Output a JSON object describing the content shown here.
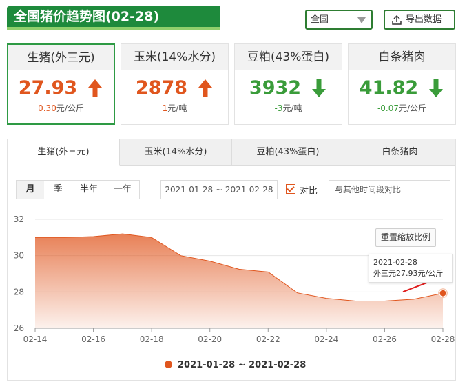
{
  "header": {
    "title": "全国猪价趋势图(02-28)"
  },
  "region": {
    "selected": "全国"
  },
  "export": {
    "label": "导出数据"
  },
  "cards": [
    {
      "title": "生猪(外三元)",
      "value": "27.93",
      "direction": "up",
      "change": "0.30",
      "unit": "元/公斤"
    },
    {
      "title": "玉米(14%水分)",
      "value": "2878",
      "direction": "up",
      "change": "1",
      "unit": "元/吨"
    },
    {
      "title": "豆粕(43%蛋白)",
      "value": "3932",
      "direction": "down",
      "change": "-3",
      "unit": "元/吨"
    },
    {
      "title": "白条猪肉",
      "value": "41.82",
      "direction": "down",
      "change": "-0.07",
      "unit": "元/公斤"
    }
  ],
  "tabs": [
    "生猪(外三元)",
    "玉米(14%水分)",
    "豆粕(43%蛋白)",
    "白条猪肉"
  ],
  "active_tab": 0,
  "ranges": [
    "月",
    "季",
    "半年",
    "一年"
  ],
  "active_range": 0,
  "date_range": "2021-01-28 ~ 2021-02-28",
  "compare": {
    "label": "对比",
    "checked": true,
    "placeholder": "与其他时间段对比"
  },
  "reset_zoom": "重置缩放比例",
  "tooltip": {
    "date": "2021-02-28",
    "text": "外三元27.93元/公斤"
  },
  "colors": {
    "primary": "#1e8a3c",
    "up": "#e0561e",
    "down": "#3a9c3a",
    "line": "#e0561e"
  },
  "chart_data": {
    "type": "area",
    "x": [
      "02-14",
      "02-15",
      "02-16",
      "02-17",
      "02-18",
      "02-19",
      "02-20",
      "02-21",
      "02-22",
      "02-23",
      "02-24",
      "02-25",
      "02-26",
      "02-27",
      "02-28"
    ],
    "series": [
      {
        "name": "2021-01-28 ~ 2021-02-28",
        "values": [
          31.0,
          31.0,
          31.05,
          31.2,
          31.0,
          30.0,
          29.7,
          29.25,
          29.1,
          27.95,
          27.65,
          27.5,
          27.5,
          27.6,
          27.93
        ]
      }
    ],
    "xticks": [
      "02-14",
      "02-16",
      "02-18",
      "02-20",
      "02-22",
      "02-24",
      "02-26",
      "02-28"
    ],
    "yticks": [
      "26",
      "28",
      "30",
      "32"
    ],
    "ylim": [
      26,
      32
    ],
    "grid": true,
    "legend": "bottom"
  }
}
